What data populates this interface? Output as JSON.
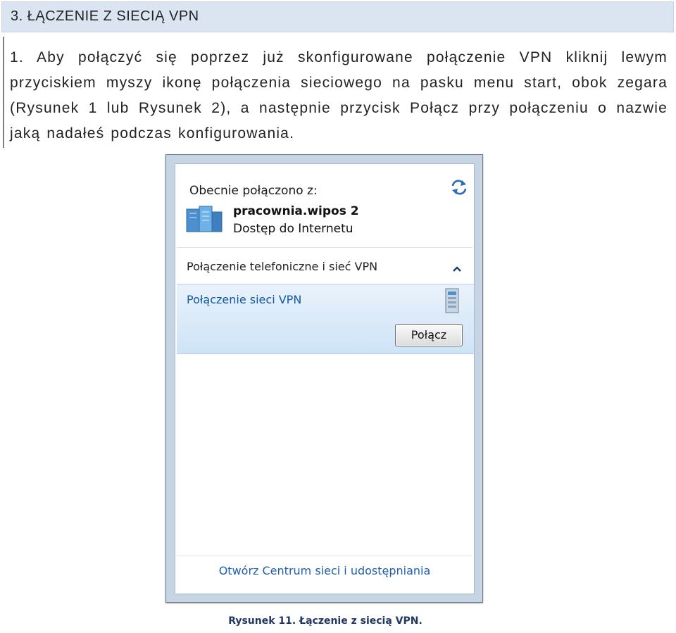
{
  "section_heading": "3.  ŁĄCZENIE Z SIECIĄ VPN",
  "step": {
    "number": "1.",
    "text": "Aby połączyć się poprzez już skonfigurowane połączenie VPN kliknij lewym przyciskiem myszy ikonę połączenia sieciowego na pasku menu start, obok zegara (Rysunek 1 lub Rysunek 2), a następnie przycisk Połącz przy połączeniu o nazwie jaką nadałeś podczas konfigurowania."
  },
  "popup": {
    "current_label": "Obecnie połączono z:",
    "connection": {
      "name": "pracownia.wipos  2",
      "status": "Dostęp do Internetu",
      "icon": "network-server-icon"
    },
    "section_header": "Połączenie telefoniczne i sieć VPN",
    "vpn_item": {
      "name": "Połączenie sieci VPN",
      "icon": "vpn-server-icon",
      "button_label": "Połącz"
    },
    "footer_link": "Otwórz Centrum sieci i udostępniania",
    "colors": {
      "link": "#1f5fae",
      "selection": "#cfe3f7",
      "frame": "#c7d4e4"
    }
  },
  "caption": "Rysunek 11. Łączenie z siecią VPN."
}
